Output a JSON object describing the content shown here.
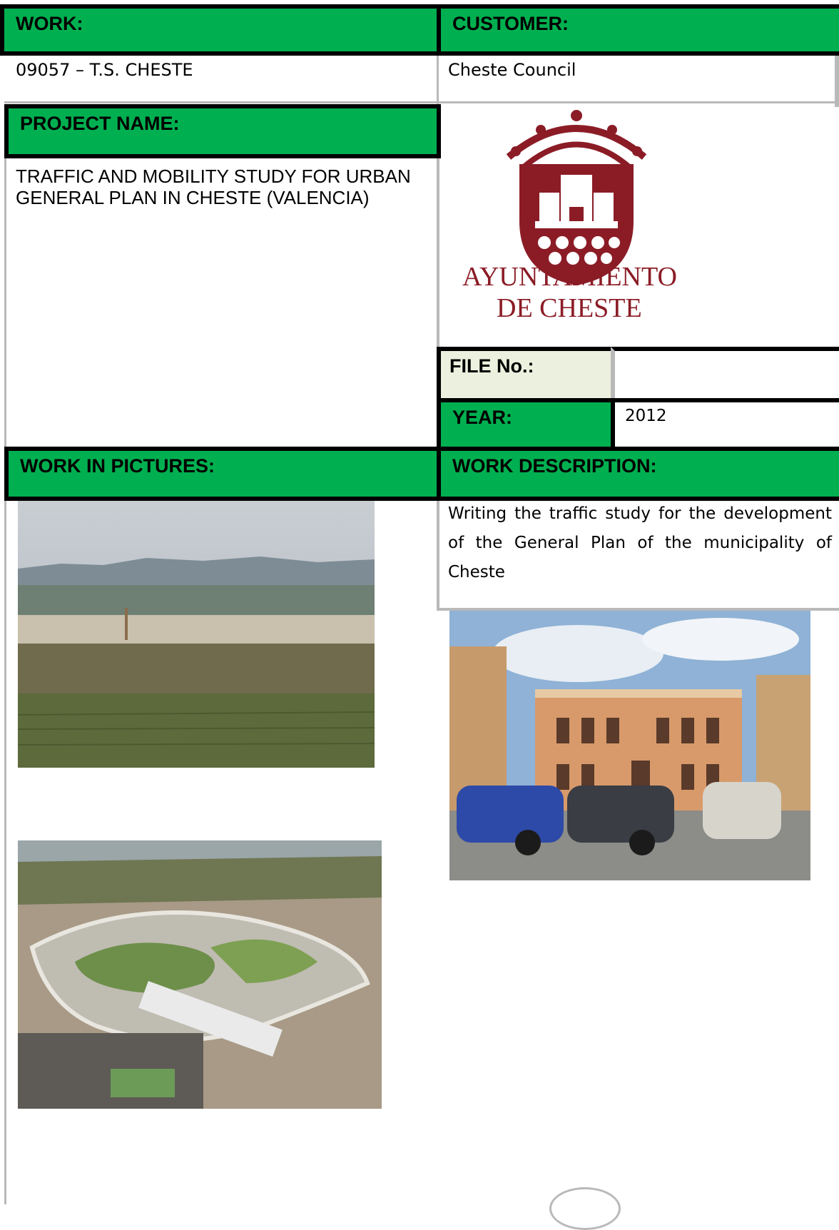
{
  "work": {
    "label": "WORK:",
    "value": "09057 – T.S. CHESTE"
  },
  "customer": {
    "label": "CUSTOMER:",
    "value": "Cheste Council"
  },
  "project": {
    "label": "PROJECT NAME:",
    "value": "TRAFFIC AND MOBILITY STUDY FOR URBAN GENERAL PLAN IN CHESTE (VALENCIA)"
  },
  "logo": {
    "line1": "AYUNTAMIENTO",
    "line2": "DE CHESTE",
    "icon": "council-crest-icon",
    "color": "#8b1c26"
  },
  "file_no": {
    "label": "FILE No.:",
    "value": ""
  },
  "year": {
    "label": "YEAR:",
    "value": "2012"
  },
  "pictures": {
    "label": "WORK IN PICTURES:"
  },
  "description": {
    "label": "WORK DESCRIPTION:",
    "text": "Writing the traffic study for the development of the General Plan of the municipality of Cheste"
  },
  "colors": {
    "header_green": "#00b050",
    "light_green": "#ebf1de",
    "border": "#000000"
  }
}
